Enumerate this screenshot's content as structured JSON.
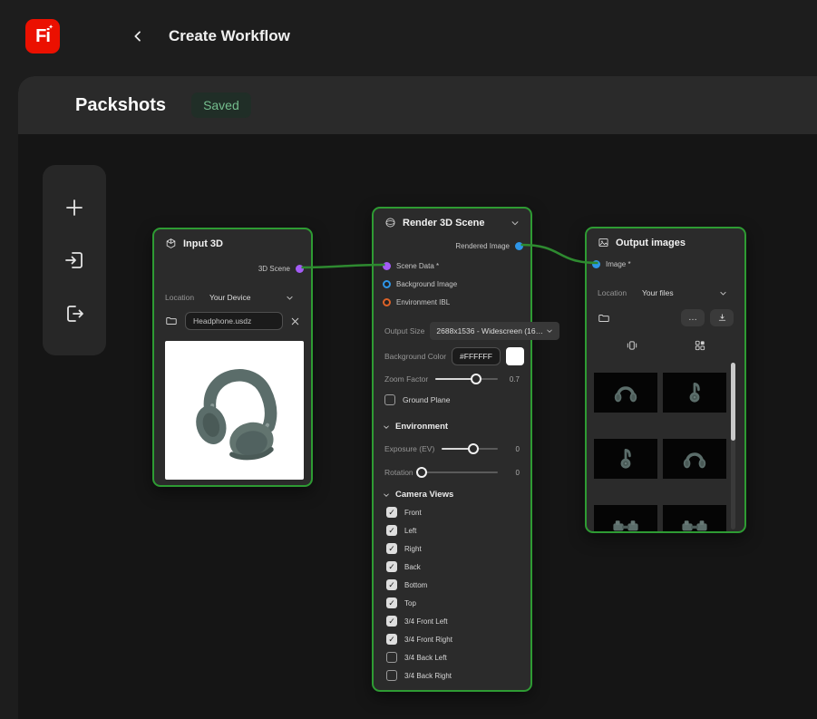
{
  "header": {
    "logo_text": "Fi",
    "title": "Create Workflow"
  },
  "panel": {
    "title": "Packshots",
    "badge": "Saved"
  },
  "toolbar": {
    "items": [
      {
        "icon": "plus-icon",
        "name": "add-node"
      },
      {
        "icon": "import-icon",
        "name": "import"
      },
      {
        "icon": "export-icon",
        "name": "export"
      }
    ]
  },
  "colors": {
    "accent_green": "#2E9B33",
    "wire_green": "#2E8A30",
    "port_purple": "#A45CF6",
    "port_blue": "#2E96E8",
    "port_orange": "#DC6228",
    "brand_red": "#EB1000",
    "saved_green": "#74BD8D",
    "background_swatch": "#FFFFFF"
  },
  "nodes": {
    "input3d": {
      "title": "Input 3D",
      "output_port": {
        "label": "3D Scene"
      },
      "location_label": "Location",
      "location_value": "Your Device",
      "file_name": "Headphone.usdz"
    },
    "render": {
      "title": "Render 3D Scene",
      "output_port": {
        "label": "Rendered Image"
      },
      "ports": [
        {
          "label": "Scene Data *"
        },
        {
          "label": "Background Image"
        },
        {
          "label": "Environment IBL"
        }
      ],
      "output_size_label": "Output Size",
      "output_size_value": "2688x1536 - Widescreen (16…",
      "background_color_label": "Background Color",
      "background_color_value": "#FFFFFF",
      "zoom": {
        "label": "Zoom Factor",
        "value": "0.7",
        "percent": 65
      },
      "ground_plane_label": "Ground Plane",
      "ground_plane_checked": false,
      "environment_section": "Environment",
      "exposure": {
        "label": "Exposure (EV)",
        "value": "0",
        "percent": 57
      },
      "rotation": {
        "label": "Rotation",
        "value": "0",
        "percent": 2
      },
      "camera_views_section": "Camera Views",
      "camera_views": [
        {
          "label": "Front",
          "checked": true
        },
        {
          "label": "Left",
          "checked": true
        },
        {
          "label": "Right",
          "checked": true
        },
        {
          "label": "Back",
          "checked": true
        },
        {
          "label": "Bottom",
          "checked": true
        },
        {
          "label": "Top",
          "checked": true
        },
        {
          "label": "3/4 Front Left",
          "checked": true
        },
        {
          "label": "3/4 Front Right",
          "checked": true
        },
        {
          "label": "3/4 Back Left",
          "checked": false
        },
        {
          "label": "3/4 Back Right",
          "checked": false
        }
      ]
    },
    "output": {
      "title": "Output images",
      "input_port": {
        "label": "Image *"
      },
      "location_label": "Location",
      "location_value": "Your files",
      "more_label": "…",
      "thumbnails": [
        {
          "view": "front"
        },
        {
          "view": "side"
        },
        {
          "view": "side"
        },
        {
          "view": "front"
        },
        {
          "view": "bottom"
        },
        {
          "view": "bottom"
        }
      ]
    }
  }
}
